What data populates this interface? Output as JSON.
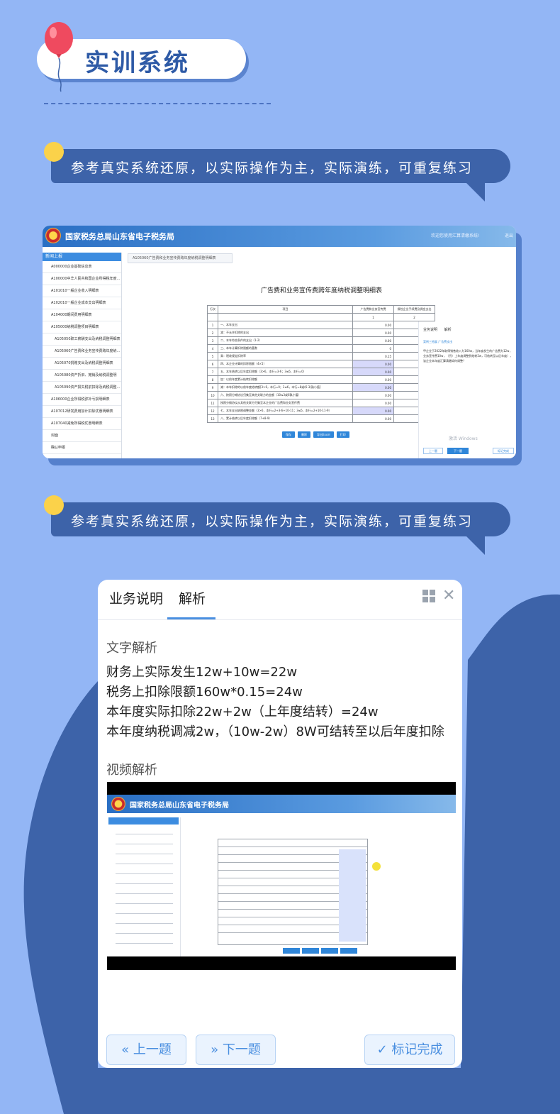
{
  "section_title": "实训系统",
  "banner1_text": "参考真实系统还原，以实际操作为主，实际演练，可重复练习",
  "banner2_text": "参考真实系统还原，以实际操作为主，实际演练，可重复练习",
  "system_screenshot": {
    "site_title": "国家税务总局山东省电子税务局",
    "welcome": "欢迎您使用汇算清缴系统!",
    "logout": "退出",
    "sidebar_header": "新闻上报",
    "sidebar_items": [
      "A000000企业基础信息表",
      "A100000中华人民共和国企业所得税年度...",
      "A101010一般企业收入明细表",
      "A102010一般企业成本支出明细表",
      "A104000期间费用明细表",
      "A105000纳税调整项目明细表",
      "A105050职工薪酬支出及纳税调整明细表",
      "A105060广告费和业务宣传费跨年度纳...",
      "A105070捐赠支出及纳税调整明细表",
      "A105080资产折旧、摊销及纳税调整明",
      "A105090资产损失税前扣除及纳税调整...",
      "A106000企业所得税弥补亏损明细表",
      "A107012研发费用加计扣除优惠明细表",
      "A107040减免所得税优惠明细表",
      "封面",
      "确认申报"
    ],
    "tab_label": "A105060广告费和业务宣传费跨年度纳税调整明细表",
    "doc_title": "广告费和业务宣传费跨年度纳税调整明细表",
    "table_headers": [
      "行次",
      "项目",
      "广告费和业务宣传费",
      "保险企业手续费及佣金支出"
    ],
    "table_subheaders": [
      "1",
      "2"
    ],
    "table_rows": [
      [
        "1",
        "一、本年支出",
        "0.00"
      ],
      [
        "2",
        "减：不允许扣除的支出",
        "0.00"
      ],
      [
        "3",
        "二、本年符合条件的支出（1-2）",
        "0.00"
      ],
      [
        "4",
        "三、本年计算扣除限额的基数",
        "0"
      ],
      [
        "5",
        "乘：税收规定扣除率",
        "0.15"
      ],
      [
        "6",
        "四、本企业计算的扣除限额（4×5）",
        "0.00"
      ],
      [
        "7",
        "五、本年结转以后年度扣除额（3>6，本行=3-6；3≤6，本行=0）",
        "0.00"
      ],
      [
        "8",
        "加：以前年度累计结转扣除额",
        "0.00"
      ],
      [
        "9",
        "减：本年扣除的以前年度结转额[3>6，本行=0；3≤6，本行=8或(6-3)孰小值]",
        "0.00"
      ],
      [
        "10",
        "六、按照分摊协议归集至其他关联方的金额（10≤3或6孰小值）",
        "0.00"
      ],
      [
        "11",
        "按照分摊协议从其他关联方归集至本企业的广告费和业务宣传费",
        "0.00"
      ],
      [
        "12",
        "七、本年支出纳税调整金额（3>6，本行=2+3-6+10-11；3≤6，本行=2+10-11-9）",
        "0.00"
      ],
      [
        "13",
        "八、累计结转以后年度扣除额（7+8-9）",
        "0.00"
      ]
    ],
    "buttons": [
      "保存",
      "删除",
      "导出Excel",
      "打印"
    ],
    "panel_tabs": [
      "业务说明",
      "解析"
    ],
    "panel_subtitle": "案例三拓展 广告费支出",
    "panel_body": "甲企业于2022年取得销售收入为160w，当年度发生的广告费为12w，业务宣传费10w，（另）上年度调整到结转2w，可结转至以后年度），该企业本年度汇算清缴如何调整？",
    "panel_watermark": "激活 Windows",
    "panel_prev": "上一题",
    "panel_next": "下一题",
    "panel_mark": "标记完成"
  },
  "analysis_card": {
    "tab_business": "业务说明",
    "tab_analysis": "解析",
    "text_section": "文字解析",
    "lines": [
      "财务上实际发生12w+10w=22w",
      "税务上扣除限额160w*0.15=24w",
      "本年度实际扣除22w+2w（上年度结转）=24w",
      "本年度纳税调减2w，（10w-2w）8W可结转至以后年度扣除"
    ],
    "video_section": "视频解析",
    "video_site_title": "国家税务总局山东省电子税务局",
    "prev_button": "« 上一题",
    "next_button": "» 下一题",
    "mark_button": "✓ 标记完成"
  },
  "colors": {
    "background": "#93b6f5",
    "banner": "#3d63a9",
    "accent": "#4a8fe0",
    "title_text": "#2e5aa6"
  }
}
